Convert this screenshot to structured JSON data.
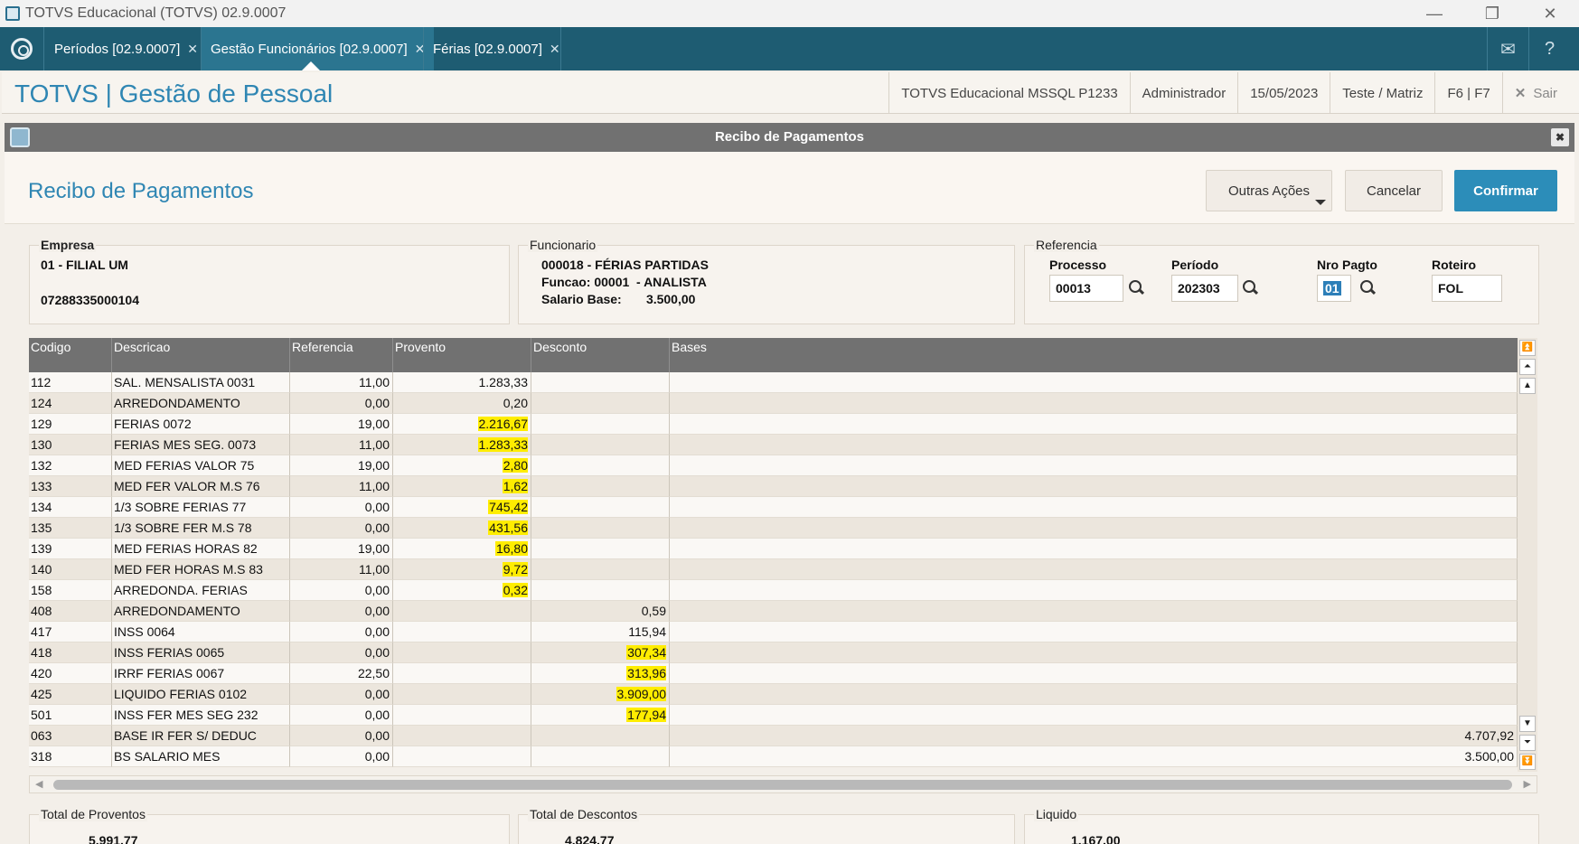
{
  "window": {
    "title": "TOTVS Educacional (TOTVS) 02.9.0007"
  },
  "tabs": [
    {
      "label": "Períodos [02.9.0007]"
    },
    {
      "label": "Gestão Funcionários [02.9.0007]"
    },
    {
      "label": "Férias [02.9.0007]"
    }
  ],
  "header": {
    "brand": "TOTVS | Gestão de Pessoal",
    "database": "TOTVS Educacional MSSQL P1233",
    "user": "Administrador",
    "date": "15/05/2023",
    "branch": "Teste / Matriz",
    "shortcuts": "F6 | F7",
    "exit_label": "Sair"
  },
  "dialog": {
    "bar_title": "Recibo de Pagamentos",
    "page_title": "Recibo de Pagamentos",
    "buttons": {
      "more": "Outras Ações",
      "cancel": "Cancelar",
      "confirm": "Confirmar"
    }
  },
  "empresa": {
    "legend": "Empresa",
    "name": "01 - FILIAL UM",
    "cnpj": "07288335000104"
  },
  "funcionario": {
    "legend": "Funcionario",
    "line1": "000018 - FÉRIAS PARTIDAS",
    "line2": "Funcao: 00001  - ANALISTA",
    "line3": "Salario Base:       3.500,00"
  },
  "referencia": {
    "legend": "Referencia",
    "processo_label": "Processo",
    "processo": "00013",
    "periodo_label": "Período",
    "periodo": "202303",
    "nro_label": "Nro Pagto",
    "nro": "01",
    "roteiro_label": "Roteiro",
    "roteiro": "FOL"
  },
  "grid": {
    "headers": [
      "Codigo",
      "Descricao",
      "Referencia",
      "Provento",
      "Desconto",
      "Bases"
    ],
    "rows": [
      {
        "codigo": "112",
        "descricao": "SAL. MENSALISTA 0031",
        "referencia": "11,00",
        "provento": "1.283,33",
        "desconto": "",
        "bases": "",
        "hl_prov": false,
        "hl_desc": false
      },
      {
        "codigo": "124",
        "descricao": "ARREDONDAMENTO",
        "referencia": "0,00",
        "provento": "0,20",
        "desconto": "",
        "bases": "",
        "hl_prov": false,
        "hl_desc": false
      },
      {
        "codigo": "129",
        "descricao": "FERIAS 0072",
        "referencia": "19,00",
        "provento": "2.216,67",
        "desconto": "",
        "bases": "",
        "hl_prov": true,
        "hl_desc": false
      },
      {
        "codigo": "130",
        "descricao": "FERIAS MES SEG. 0073",
        "referencia": "11,00",
        "provento": "1.283,33",
        "desconto": "",
        "bases": "",
        "hl_prov": true,
        "hl_desc": false
      },
      {
        "codigo": "132",
        "descricao": "MED FERIAS VALOR  75",
        "referencia": "19,00",
        "provento": "2,80",
        "desconto": "",
        "bases": "",
        "hl_prov": true,
        "hl_desc": false
      },
      {
        "codigo": "133",
        "descricao": "MED FER VALOR M.S 76",
        "referencia": "11,00",
        "provento": "1,62",
        "desconto": "",
        "bases": "",
        "hl_prov": true,
        "hl_desc": false
      },
      {
        "codigo": "134",
        "descricao": "1/3 SOBRE FERIAS 77",
        "referencia": "0,00",
        "provento": "745,42",
        "desconto": "",
        "bases": "",
        "hl_prov": true,
        "hl_desc": false
      },
      {
        "codigo": "135",
        "descricao": "1/3 SOBRE FER M.S 78",
        "referencia": "0,00",
        "provento": "431,56",
        "desconto": "",
        "bases": "",
        "hl_prov": true,
        "hl_desc": false
      },
      {
        "codigo": "139",
        "descricao": "MED FERIAS HORAS 82",
        "referencia": "19,00",
        "provento": "16,80",
        "desconto": "",
        "bases": "",
        "hl_prov": true,
        "hl_desc": false
      },
      {
        "codigo": "140",
        "descricao": "MED FER HORAS M.S 83",
        "referencia": "11,00",
        "provento": "9,72",
        "desconto": "",
        "bases": "",
        "hl_prov": true,
        "hl_desc": false
      },
      {
        "codigo": "158",
        "descricao": "ARREDONDA. FERIAS",
        "referencia": "0,00",
        "provento": "0,32",
        "desconto": "",
        "bases": "",
        "hl_prov": true,
        "hl_desc": false
      },
      {
        "codigo": "408",
        "descricao": "ARREDONDAMENTO",
        "referencia": "0,00",
        "provento": "",
        "desconto": "0,59",
        "bases": "",
        "hl_prov": false,
        "hl_desc": false
      },
      {
        "codigo": "417",
        "descricao": "INSS 0064",
        "referencia": "0,00",
        "provento": "",
        "desconto": "115,94",
        "bases": "",
        "hl_prov": false,
        "hl_desc": false
      },
      {
        "codigo": "418",
        "descricao": "INSS FERIAS 0065",
        "referencia": "0,00",
        "provento": "",
        "desconto": "307,34",
        "bases": "",
        "hl_prov": false,
        "hl_desc": true
      },
      {
        "codigo": "420",
        "descricao": "IRRF FERIAS 0067",
        "referencia": "22,50",
        "provento": "",
        "desconto": "313,96",
        "bases": "",
        "hl_prov": false,
        "hl_desc": true
      },
      {
        "codigo": "425",
        "descricao": "LIQUIDO FERIAS 0102",
        "referencia": "0,00",
        "provento": "",
        "desconto": "3.909,00",
        "bases": "",
        "hl_prov": false,
        "hl_desc": true
      },
      {
        "codigo": "501",
        "descricao": "INSS FER MES SEG 232",
        "referencia": "0,00",
        "provento": "",
        "desconto": "177,94",
        "bases": "",
        "hl_prov": false,
        "hl_desc": true
      },
      {
        "codigo": "063",
        "descricao": "BASE IR FER S/ DEDUC",
        "referencia": "0,00",
        "provento": "",
        "desconto": "",
        "bases": "4.707,92",
        "hl_prov": false,
        "hl_desc": false
      },
      {
        "codigo": "318",
        "descricao": "BS SALARIO MES",
        "referencia": "0,00",
        "provento": "",
        "desconto": "",
        "bases": "3.500,00",
        "hl_prov": false,
        "hl_desc": false
      }
    ]
  },
  "totals": {
    "proventos_label": "Total de Proventos",
    "proventos": "5.991,77",
    "descontos_label": "Total de Descontos",
    "descontos": "4.824,77",
    "liquido_label": "Liquido",
    "liquido": "1.167,00"
  },
  "colors": {
    "tabbar": "#1e5c72",
    "accent": "#2f86b3",
    "confirm": "#2c8db9",
    "highlight": "#ffed00",
    "grid_header": "#717171"
  }
}
